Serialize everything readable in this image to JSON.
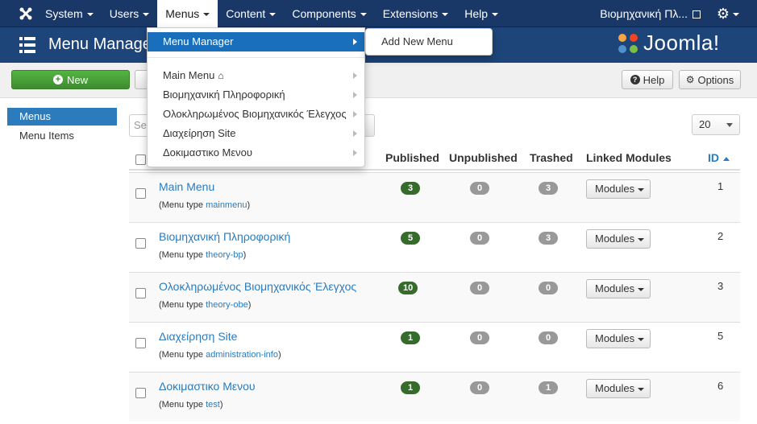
{
  "navbar": {
    "items": [
      {
        "label": "System"
      },
      {
        "label": "Users"
      },
      {
        "label": "Menus"
      },
      {
        "label": "Content"
      },
      {
        "label": "Components"
      },
      {
        "label": "Extensions"
      },
      {
        "label": "Help"
      }
    ],
    "site_name": "Βιομηχανική Πλ..."
  },
  "header": {
    "title": "Menu Manage",
    "logo_text": "Joomla!"
  },
  "toolbar": {
    "new_label": "New",
    "help_label": "Help",
    "options_label": "Options"
  },
  "sidebar": {
    "items": [
      {
        "label": "Menus"
      },
      {
        "label": "Menu Items"
      }
    ]
  },
  "filters": {
    "search_placeholder": "Se",
    "limit": "20"
  },
  "table": {
    "columns": {
      "published": "Published",
      "unpublished": "Unpublished",
      "trashed": "Trashed",
      "linked_modules": "Linked Modules",
      "id": "ID"
    },
    "modules_label": "Modules",
    "menu_type_prefix": "(Menu type ",
    "menu_type_suffix": ")",
    "rows": [
      {
        "title": "Main Menu",
        "menutype": "mainmenu",
        "published": "3",
        "unpublished": "0",
        "trashed": "3",
        "id": "1"
      },
      {
        "title": "Βιομηχανική Πληροφορική",
        "menutype": "theory-bp",
        "published": "5",
        "unpublished": "0",
        "trashed": "3",
        "id": "2"
      },
      {
        "title": "Ολοκληρωμένος Βιομηχανικός Έλεγχος",
        "menutype": "theory-obe",
        "published": "10",
        "unpublished": "0",
        "trashed": "0",
        "id": "3"
      },
      {
        "title": "Διαχείρηση Site",
        "menutype": "administration-info",
        "published": "1",
        "unpublished": "0",
        "trashed": "0",
        "id": "5"
      },
      {
        "title": "Δοκιμαστικο Μενου",
        "menutype": "test",
        "published": "1",
        "unpublished": "0",
        "trashed": "1",
        "id": "6"
      }
    ]
  },
  "dropdown": {
    "manager_label": "Menu Manager",
    "submenu_label": "Add New Menu",
    "items": [
      {
        "label": "Main Menu"
      },
      {
        "label": "Βιομηχανική Πληροφορική"
      },
      {
        "label": "Ολοκληρωμένος Βιομηχανικός Έλεγχος"
      },
      {
        "label": "Διαχείρηση Site"
      },
      {
        "label": "Δοκιμαστικο Μενου"
      }
    ]
  },
  "colors": {
    "navbar": "#1a3867",
    "header": "#1d4579",
    "accent": "#2b7bbd",
    "new_button": "#46a035",
    "published_badge": "#356c2c",
    "neutral_badge": "#999999"
  },
  "icons": [
    "joomla-icon",
    "external-link-icon",
    "gear-icon",
    "menu-list-icon",
    "plus-circle-icon",
    "question-circle-icon",
    "home-icon",
    "caret-down-icon",
    "caret-right-icon",
    "sort-up-icon"
  ]
}
